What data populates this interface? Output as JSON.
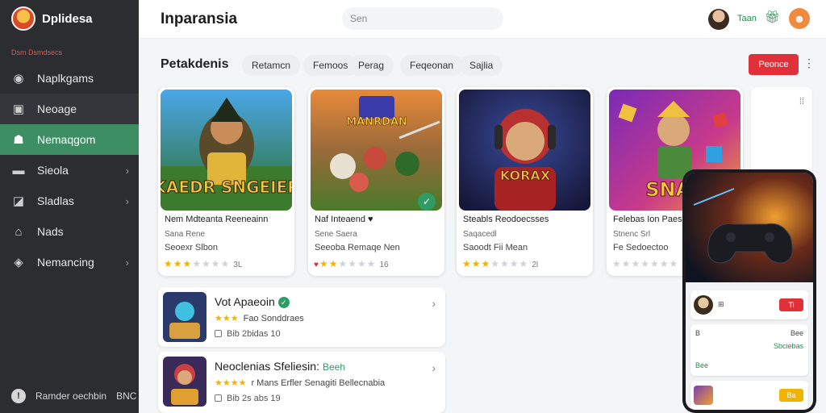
{
  "brand": {
    "name": "Dplidesa"
  },
  "sidebar": {
    "section_label": "Dsm Dsmdsecs",
    "items": [
      {
        "label": "Naplkgams",
        "icon": "gamepad-icon"
      },
      {
        "label": "Neoage",
        "icon": "briefcase-icon"
      },
      {
        "label": "Nemaqgom",
        "icon": "users-icon"
      },
      {
        "label": "Sieola",
        "icon": "folder-icon"
      },
      {
        "label": "Sladlas",
        "icon": "chart-icon"
      },
      {
        "label": "Nads",
        "icon": "lock-icon"
      },
      {
        "label": "Nemancing",
        "icon": "cube-icon"
      }
    ],
    "footer_label": "Ramder oechbin",
    "footer_suffix": "BNC"
  },
  "header": {
    "title": "Inparansia",
    "search_placeholder": "Sen",
    "top_label": "Taan"
  },
  "toolbar": {
    "section_title": "Petakdenis",
    "chips": [
      "Retamcn",
      "Femoos",
      "Perag",
      "Feqeonan",
      "Sajlia"
    ],
    "primary_label": "Peonce",
    "more": "⋮"
  },
  "colors": {
    "accent": "#3e8e63",
    "danger": "#e0303a",
    "sidebar": "#2b2d31",
    "star": "#f3b400"
  },
  "cards": [
    {
      "art_text": "KAEDR SNGEIER",
      "title": "Nem Mdteanta Reeneainn",
      "meta": "Sana Rene",
      "sub": "Seoexr Slbon",
      "rating": 3,
      "count": "3L"
    },
    {
      "art_text": "MANRDAN",
      "title": "Naf Inteaend ♥",
      "meta": "Sene Saera",
      "sub": "Seeoba Remaqe Nen",
      "rating": 2,
      "count": "16"
    },
    {
      "art_text": "KORAX",
      "title": "Steabls Reodoecsses",
      "meta": "Saqacedl",
      "sub": "Saoodt Fii Mean",
      "rating": 3,
      "count": "2l"
    },
    {
      "art_text": "SNAP",
      "title": "Felebas Ion Paesaenas",
      "meta": "Stnenc Srl",
      "sub": "Fe Sedoectoo",
      "rating": 0,
      "count": ""
    }
  ],
  "list": [
    {
      "title": "Vot Apaeoin",
      "tag": "",
      "stars": 3,
      "desc": "Fao Sonddraes",
      "meta": "Bib 2bidas 10"
    },
    {
      "title": "Neoclenias Sfeliesin:",
      "tag": "Beeh",
      "stars": 4,
      "desc": "r Mans Erfler Senagiti Bellecnabia",
      "meta": "Bib 2s abs 19"
    }
  ],
  "phone": {
    "row1_btn": "Ti",
    "row2_left": "B",
    "row2_right": "Sbciebas",
    "row2_mid": "Bee",
    "row2_right2": "Bee",
    "row3_btn": "Ba"
  }
}
